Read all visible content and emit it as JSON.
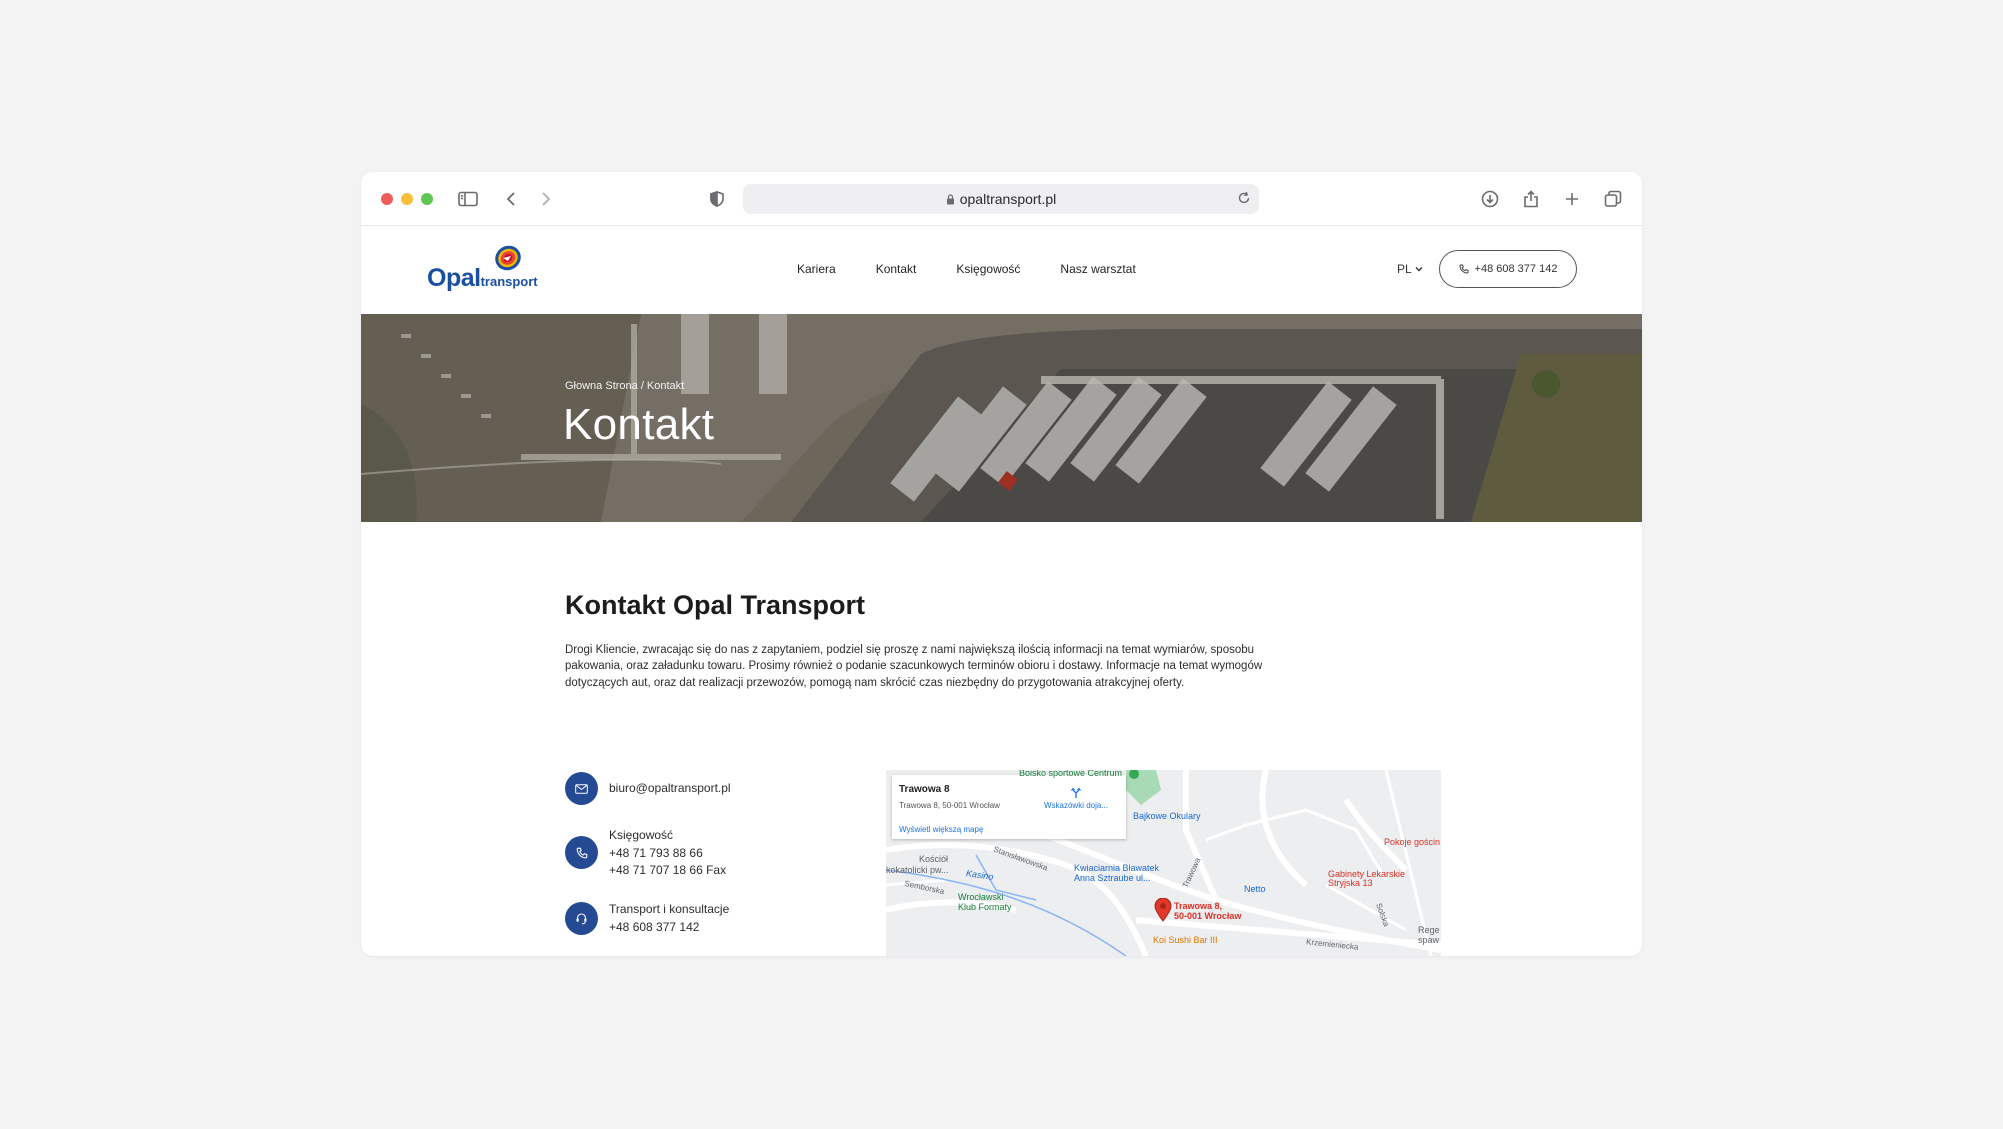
{
  "browser": {
    "url": "opaltransport.pl"
  },
  "nav": {
    "logo_main": "Opal",
    "logo_sub": "transport",
    "menu": [
      "Kariera",
      "Kontakt",
      "Księgowość",
      "Nasz warsztat"
    ],
    "lang": "PL",
    "phone": "+48 608 377 142"
  },
  "hero": {
    "breadcrumb": "Głowna Strona / Kontakt",
    "title": "Kontakt"
  },
  "content": {
    "title": "Kontakt Opal Transport",
    "intro": "Drogi Kliencie, zwracając się do nas z zapytaniem, podziel się proszę z nami największą ilością informacji na temat wymiarów, sposobu pakowania, oraz załadunku towaru. Prosimy również o podanie szacunkowych terminów obioru i dostawy. Informacje na temat wymogów dotyczących aut, oraz dat realizacji przewozów, pomogą nam skrócić czas niezbędny do przygotowania atrakcyjnej oferty."
  },
  "contacts": {
    "email": "biuro@opaltransport.pl",
    "accounting_label": "Księgowość",
    "accounting_phone": "+48 71 793 88 66",
    "accounting_fax": "+48 71 707 18 66 Fax",
    "transport_label": "Transport i konsultacje",
    "transport_phone": "+48 608 377 142"
  },
  "map": {
    "place_title": "Trawowa 8",
    "place_address": "Trawowa 8, 50-001 Wrocław",
    "directions": "Wskazówki doja...",
    "bigger_map": "Wyświetl większą mapę",
    "pin_label_1": "Trawowa 8,",
    "pin_label_2": "50-001 Wrocław",
    "labels": {
      "sport": "Boisko sportowe Centrum",
      "glasses": "Bajkowe Okulary",
      "church_1": "Kościół",
      "church_2": "kokatolicki pw...",
      "kasino": "Kasino",
      "florist_1": "Kwiaciarnia Bławatek",
      "florist_2": "Anna Sztraube ul...",
      "club_1": "Wrocławski",
      "club_2": "Klub Formaty",
      "netto": "Netto",
      "sushi": "Koi Sushi Bar III",
      "clinic_1": "Gabinety Lekarskie",
      "clinic_2": "Stryjska 13",
      "rooms": "Pokoje gościn",
      "rege_1": "Rege",
      "rege_2": "spaw",
      "street_1": "Stanisławowska",
      "street_2": "Semborska",
      "street_3": "Trawowa",
      "street_4": "Krzemieniecka",
      "street_5": "Solska"
    }
  },
  "colors": {
    "brand_blue": "#234a93",
    "link_blue": "#1a73e8",
    "pin_red": "#e3372d"
  }
}
